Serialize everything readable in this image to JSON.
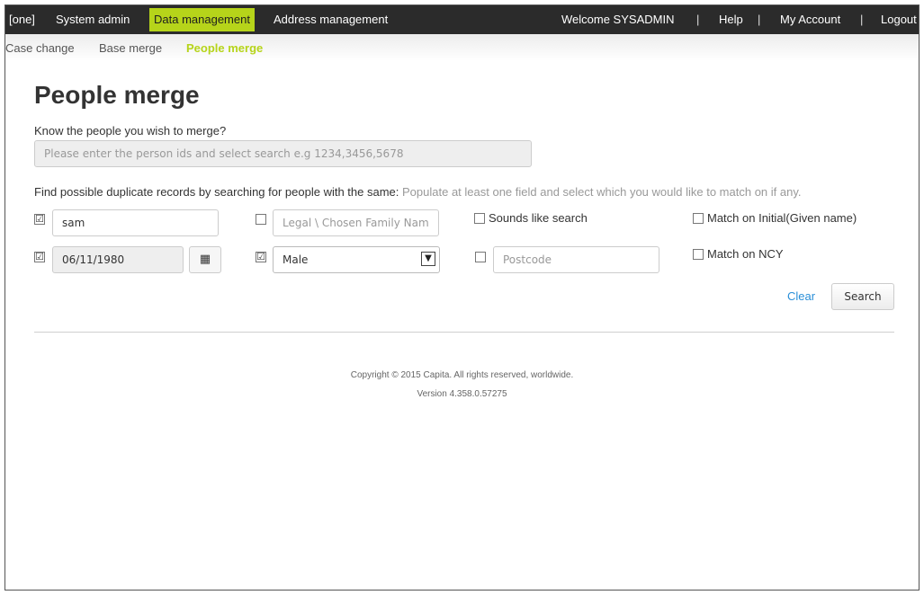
{
  "topbar": {
    "brand": "[one]",
    "menu": [
      "System admin",
      "Data management",
      "Address management"
    ],
    "welcome": "Welcome SYSADMIN",
    "help": "Help",
    "account": "My Account",
    "logout": "Logout",
    "separator": "|"
  },
  "subnav": [
    "Case change",
    "Base merge",
    "People merge"
  ],
  "page": {
    "title": "People merge",
    "know_label": "Know the people you wish to merge?",
    "ids_placeholder": "Please enter the person ids and select search e.g 1234,3456,5678",
    "find_label": "Find possible duplicate records by searching for people with the same:",
    "find_hint": "Populate at least one field and select which you would like to match on if any."
  },
  "form": {
    "given_name": {
      "checked": true,
      "value": "sam"
    },
    "family_name": {
      "checked": false,
      "placeholder": "Legal \\ Chosen Family Nam"
    },
    "sounds_like": {
      "checked": false,
      "label": "Sounds like search"
    },
    "match_initial": {
      "checked": false,
      "label": "Match on Initial(Given name)"
    },
    "dob": {
      "checked": true,
      "value": "06/11/1980"
    },
    "gender": {
      "checked": true,
      "value": "Male"
    },
    "postcode": {
      "checked": false,
      "placeholder": "Postcode"
    },
    "match_ncy": {
      "checked": false,
      "label": "Match on NCY"
    },
    "check_mark": "☑"
  },
  "actions": {
    "clear": "Clear",
    "search": "Search"
  },
  "footer": {
    "copyright": "Copyright © 2015 Capita. All rights reserved, worldwide.",
    "version": "Version 4.358.0.57275"
  },
  "icons": {
    "calendar": "calendar-icon",
    "dropdown": "chevron-down-icon"
  },
  "colors": {
    "accent": "#b6d41a",
    "topbar": "#2b2b2b",
    "link": "#2a8fd8"
  }
}
